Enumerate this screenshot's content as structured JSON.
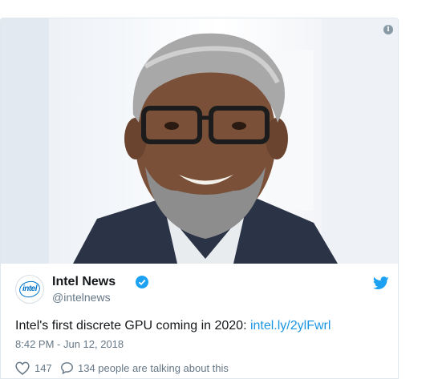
{
  "tweet": {
    "author_name": "Intel News",
    "author_handle": "@intelnews",
    "avatar_text": "intel",
    "text": "Intel's first discrete GPU coming in 2020: ",
    "link": "intel.ly/2ylFwrl",
    "timestamp": "8:42 PM - Jun 12, 2018",
    "likes": "147",
    "talking": "134 people are talking about this"
  },
  "icons": {
    "info": "info-icon",
    "verified": "verified-badge-icon",
    "brand": "twitter-bird-icon",
    "like": "heart-icon",
    "reply": "speech-bubble-icon"
  },
  "colors": {
    "accent": "#1b95e0",
    "muted": "#657786",
    "intel_blue": "#0071c5"
  }
}
